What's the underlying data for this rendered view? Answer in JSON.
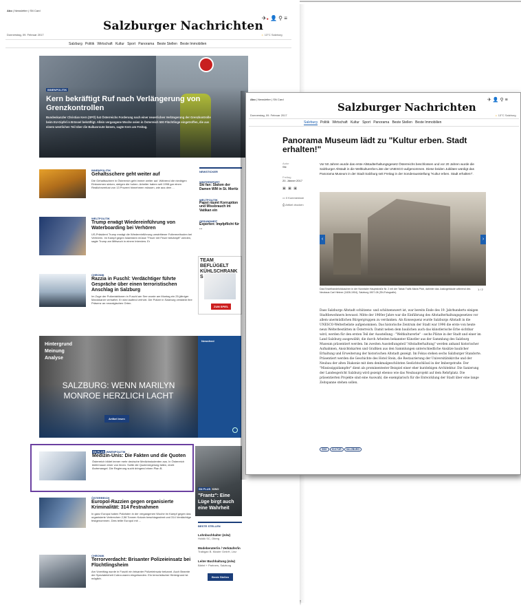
{
  "p1": {
    "top_links": [
      "Abo",
      "Newsletter",
      "SN Card"
    ],
    "date": "Donnerstag, 09. Februar 2017",
    "masthead": "Salzburger Nachrichten",
    "weather": "13°C Salzburg",
    "nav": [
      "Salzburg",
      "Politik",
      "Wirtschaft",
      "Kultur",
      "Sport",
      "Panorama",
      "Beste Stellen",
      "Beste Immobilien"
    ],
    "hero": {
      "tag": "INNENPOLITIK",
      "title": "Kern bekräftigt Ruf nach Verlängerung von Grenzkontrollen",
      "teaser": "Bundeskanzler Christian Kern (SPÖ) hat Österreichs Forderung nach einer neuerlichen Verlängerung der Grenzkontrolle beim EU-Gipfel in Brüssel bekräftigt. Allein vergangene Woche seien in Österreich 500 Flüchtlinge eingetroffen, die aus einem westlichen Teil über die Balkanroute kämen, sagte Kern am Freitag."
    },
    "articles": [
      {
        "tag": "INNENPOLITIK",
        "title": "Gehaltsschere geht weiter auf",
        "teaser": "Die Gehaltsschere in Österreich geht immer weiter auf. Während die niedrigen Einkommen sinken, steigen die hohen. Arbeiter haben seit 1998 gar einen Reallohnverlust von 13 Prozent hinnehmen müssen, wie aus dem ..."
      },
      {
        "tag": "WELTPOLITIK",
        "title": "Trump erwägt Wiedereinführung von Waterboarding bei Verhören",
        "teaser": "US-Präsident Trump erwägt die Wiedereinführung umstrittener Foltermethoden bei Verhören. Im Kampf gegen Islamisten müsse \"Feuer mit Feuer bekämpft\" werden, sagte Trump am Mittwoch in einem Interview. Er"
      },
      {
        "tag": "CHRONIK",
        "title": "Razzia in Fuschl: Verdächtiger führte Gespräche über einen terroristischen Anschlag in Salzburg",
        "teaser": "Im Zuge der Polizeiaktionen in Fuschl am See wurde am Montag ein 25-jähriger Marokkaner verhaftet. Er wird laufend verhört. Die Polizei in Salzburg verstärkt ihre Präsenz an neuralgischen Orten."
      }
    ],
    "sidebar": {
      "items": [
        {
          "tag": "NEWSTICKER",
          "text": ""
        },
        {
          "tag": "WINTERSPORT",
          "text": "Ski fan: Slalom der Damen WM in St. Moritz"
        },
        {
          "tag": "WELTPOLITIK",
          "text": "Papst räumt Korruption und Missbrauch im Vatikan ein"
        },
        {
          "tag": "GESUNDHEIT",
          "text": "Experten: Impfpflicht für ..."
        }
      ],
      "ad": "TEAM BEFLÜGELT KÜHLSCHRANK S",
      "ad_button": "ZUM SPIEL"
    },
    "marilyn": {
      "labels": [
        "Hintergrund",
        "Meinung",
        "Analyse"
      ],
      "title": "SALZBURG: WENN MARILYN MONROE HERZLICH LACHT",
      "button": "Artikel lesen",
      "side_label": "Newsfeed"
    },
    "featured": {
      "badge": "SN PLUS",
      "tag": "INNENPOLITIK",
      "title": "Medizin-Unis: Die Fakten und die Quoten",
      "teaser": "Österreich bildet immer mehr deutsche Medizinstudenten aus. In Österreich bleibt kaum einer von ihnen. Sollte die Quotenregelung fallen, droht Ärztemangel. Die Regierung sucht dringend einen Plan B."
    },
    "frantz": {
      "badge": "SN PLUS",
      "tag": "KINO",
      "title": "\"Frantz\": Eine Lüge birgt auch eine Wahrheit"
    },
    "articles2": [
      {
        "tag": "ÖSTERREICH",
        "title": "Europol-Razzien gegen organisierte Kriminalität: 314 Festnahmen",
        "teaser": "In ganz Europa haben Polizisten in der vergangenen Woche im Kampf gegen das organisierte Verbrechen 2,58 Tonnen Kokain beschlagnahmt und 314 Verdächtige festgenommen. Dies teilte Europol mit ..."
      },
      {
        "tag": "CHRONIK",
        "title": "Terrorverdacht: Brisanter Polizeieinsatz bei Flüchtlingsheim",
        "teaser": "Am Vormittag wurde in Fuschl ein brisanter Polizeieinsatz bekannt. Auch Beamte der Spezialeinheit Cobra waren eingebunden. Ein terroristischer Hintergrund ist möglich."
      }
    ],
    "jobs": {
      "header": "BESTE STELLEN",
      "items": [
        {
          "title": "Lohnbuchhalter (m/w)",
          "company": "Holdik SC, Oberg"
        },
        {
          "title": "Modeberater/in / Verkäufer/in",
          "company": "Trabigan B. Muster GmbH, Linz"
        },
        {
          "title": "Leiter Buchhaltung (m/w)",
          "company": "Bärtel + Partners, Salzburg"
        }
      ],
      "button": "Beste Stellen"
    }
  },
  "p2": {
    "top_links": [
      "Abo",
      "Newsletter",
      "SN Card"
    ],
    "date": "Donnerstag, 09. Februar 2017",
    "masthead": "Salzburger Nachrichten",
    "weather": "13°C Salzburg",
    "nav": [
      "Salzburg",
      "Politik",
      "Wirtschaft",
      "Kultur",
      "Sport",
      "Panorama",
      "Beste Stellen",
      "Beste Immobilien"
    ],
    "title": "Panorama Museum lädt zu \"Kultur erben. Stadt erhalten!\"",
    "author_label": "Autor",
    "author": "SN",
    "date_label": "Freitag",
    "article_date": "20. Jänner 2017",
    "comments": "0 Kommentare",
    "read_aloud": "Artikel drucken",
    "intro": "Vor 50 Jahren wurde das erste Altstadterhaltungsgesetz Österreichs beschlossen und vor 20 Jahren wurde die Salzburger Altstadt in die Weltkulturerbe-Liste der UNESCO aufgenommen. Diese beiden Jubiläen würdigt das Panorama Museum in der Stadt Salzburg seit Freitag in der Sonderausstellung \"Kultur erben. Stadt erhalten!\".",
    "caption": "Das Einzelhandelshäuschen in der Nonntaler Hauptstraße Nr. 2 mit der Tabak Trafik Maria Pfob, dahinter das Justizgebäude während des Neubaus Carl Hintner (1828-1904), Salzburg 1907-08 (SN-Fotografie).",
    "counter": "1 / 2",
    "body": "Dass Salzburgs Altstadt schützens- und schützenswert ist, war bereits Ende des 19. Jahrhunderts einigen Stadtbewohnern bewusst. Mitte der 1960er Jahre war die Einführung des Altstadterhaltungsgesetzes vor allem unermüdlichen Bürgergruppen zu verdanken. Als Konsequenz wurde Salzburgs Altstadt in die UNESCO-Welterbeliste aufgenommen. Das historische Zentrum der Stadt war 1996 die erste von heute neun Welterbestätten in Österreich. Damit neben dem baulichen auch das künstlerische Erbe sichtbar wird, werden für den ersten Teil der Ausstellung - \"Weltkulturerbe\" - sechs Plätze in der Stadt und einer im Land Salzburg ausgewählt, die durch Arbeiten bekannter Künstler aus der Sammlung des Salzburg Museum präsentiert werden. Im zweiten Ausstellungsteil \"Altstadterhaltung\" werden anhand historischer Aufnahmen, Ansichtskarten und Grafiken aus den Sammlungen unterschiedliche Ansätze baulicher Erhaltung und Erweiterung der historischen Altstadt gezeigt. Im Fokus stehen sechs Salzburger Standorte. Präsentiert werden die Geschichte des Hotel Stein, die Restaurierung der Universitätskirche und der Neubau der alten Diakonie mit dem denkmalgeschützten Seelichtschlössl in der Imbergstraße. Der \"Mississippidampfer\" dient als prominentester Beispiel einer eher kurzlebigen Architektur. Die Sanierung der Landesgericht Salzburg wird gezeigt ebenso wie das Neubauprojekt auf dem Rehrlplatz. Die präsentierten Projekte sind eine Auswahl, die exemplarisch für die Entwicklung der Stadt über eine lange Zeitspanne stehen sollen.",
    "tags": [
      "SBG",
      "KULTUR",
      "SALZBURG"
    ]
  },
  "colors": {
    "brand_blue": "#1b3e7a",
    "purple_frame": "#6a3fa0",
    "red": "#cc1f1f"
  }
}
